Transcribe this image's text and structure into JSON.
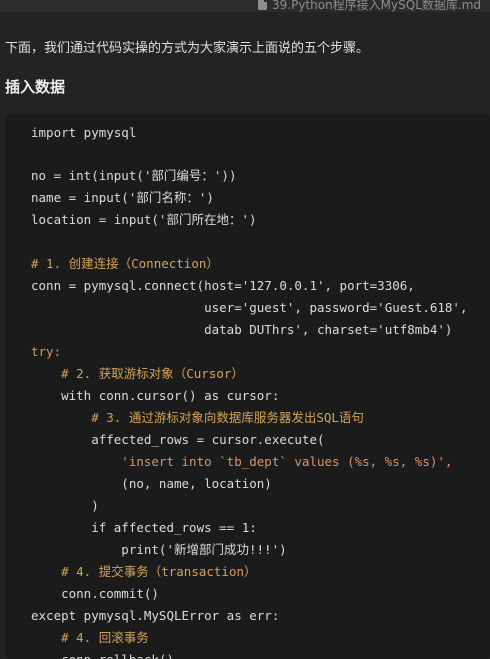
{
  "window": {
    "title": "39.Python程序接入MySQL数据库.md",
    "icon": "file-icon"
  },
  "doc": {
    "intro": "下面，我们通过代码实操的方式为大家演示上面说的五个步骤。",
    "heading": "插入数据"
  },
  "code": [
    "import pymysql",
    "",
    "no = int(input('部门编号：'))",
    "name = input('部门名称：')",
    "location = input('部门所在地：')",
    "",
    "# 1. 创建连接（Connection）",
    "conn = pymysql.connect(host='127.0.0.1', port=3306,",
    "                       user='guest', password='Guest.618',",
    "                       datab⁠ DUThrs', charset='utf8mb4')",
    "try:",
    "    # 2. 获取游标对象（Cursor）",
    "    with conn.cursor() as cursor:",
    "        # 3. 通过游标对象向数据库服务器发出SQL语句",
    "        affected_rows = cursor.execute(",
    "            'insert into `tb_dept` values (%s, %s, %s)',",
    "            (no, name, location)",
    "        )",
    "        if affected_rows == 1:",
    "            print('新增部门成功!!!')",
    "    # 4. 提交事务（transaction）",
    "    conn.commit()",
    "except pymysql.MySQLError as err:",
    "    # 4. 回滚事务",
    "    conn.rollback()"
  ],
  "colors": {
    "background": "#232323",
    "code_background": "#1b1b1b",
    "keyword": "#d19a66",
    "string": "#d8956b",
    "comment": "#d3a35a"
  }
}
